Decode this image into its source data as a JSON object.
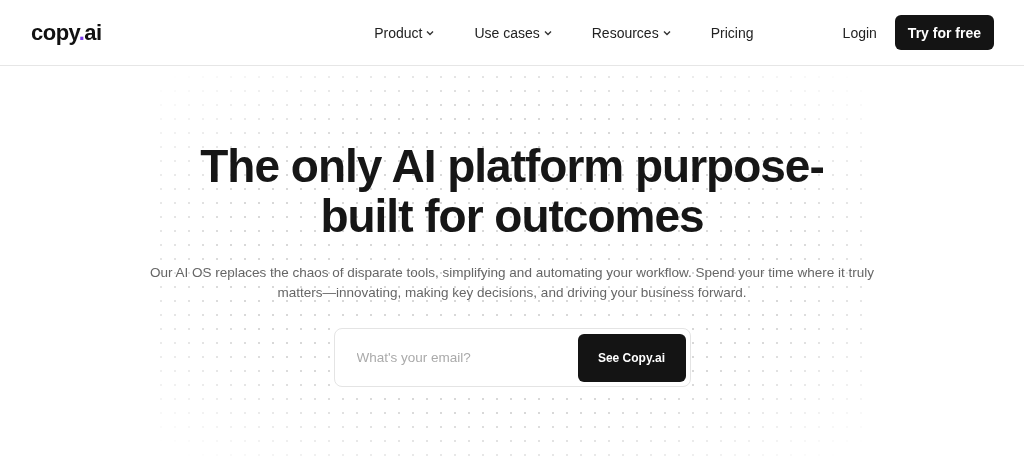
{
  "header": {
    "logo": {
      "text_before": "copy",
      "dot": ".",
      "text_after": "ai"
    },
    "nav": [
      {
        "label": "Product",
        "dropdown": true
      },
      {
        "label": "Use cases",
        "dropdown": true
      },
      {
        "label": "Resources",
        "dropdown": true
      },
      {
        "label": "Pricing",
        "dropdown": false
      }
    ],
    "login": "Login",
    "cta": "Try for free"
  },
  "hero": {
    "headline": "The only AI platform purpose-built for outcomes",
    "subtitle": "Our AI OS replaces the chaos of disparate tools, simplifying and automating your workflow. Spend your time where it truly matters—innovating, making key decisions, and driving your business forward.",
    "email": {
      "placeholder": "What's your email?",
      "button": "See Copy.ai"
    }
  }
}
